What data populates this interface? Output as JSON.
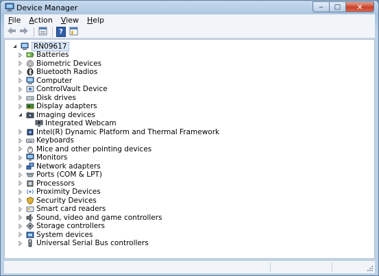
{
  "window": {
    "title": "Device Manager",
    "caption_minimize": "‒",
    "caption_maximize": "□",
    "caption_close": "✕"
  },
  "menu": [
    {
      "label": "File",
      "accel": "F",
      "rest": "ile"
    },
    {
      "label": "Action",
      "accel": "A",
      "rest": "ction"
    },
    {
      "label": "View",
      "accel": "V",
      "rest": "iew"
    },
    {
      "label": "Help",
      "accel": "H",
      "rest": "elp"
    }
  ],
  "toolbar": {
    "back_icon": "back-arrow-icon",
    "forward_icon": "forward-arrow-icon",
    "properties_icon": "properties-icon",
    "help_icon": "help-icon",
    "help_glyph": "?",
    "show_hide_icon": "show-hide-console-tree-icon"
  },
  "tree": {
    "root": {
      "label": "RN09617",
      "icon": "computer-icon",
      "expanded": true
    },
    "items": [
      {
        "label": "Batteries",
        "icon": "battery-icon",
        "expanded": false,
        "level": 1
      },
      {
        "label": "Biometric Devices",
        "icon": "fingerprint-icon",
        "expanded": false,
        "level": 1
      },
      {
        "label": "Bluetooth Radios",
        "icon": "bluetooth-icon",
        "expanded": false,
        "level": 1
      },
      {
        "label": "Computer",
        "icon": "computer-icon",
        "expanded": false,
        "level": 1
      },
      {
        "label": "ControlVault Device",
        "icon": "controlvault-icon",
        "expanded": false,
        "level": 1
      },
      {
        "label": "Disk drives",
        "icon": "disk-drive-icon",
        "expanded": false,
        "level": 1
      },
      {
        "label": "Display adapters",
        "icon": "display-adapter-icon",
        "expanded": false,
        "level": 1
      },
      {
        "label": "Imaging devices",
        "icon": "camera-icon",
        "expanded": true,
        "level": 1
      },
      {
        "label": "Integrated Webcam",
        "icon": "webcam-icon",
        "expanded": null,
        "level": 2
      },
      {
        "label": "Intel(R) Dynamic Platform and Thermal Framework",
        "icon": "chip-icon",
        "expanded": false,
        "level": 1
      },
      {
        "label": "Keyboards",
        "icon": "keyboard-icon",
        "expanded": false,
        "level": 1
      },
      {
        "label": "Mice and other pointing devices",
        "icon": "mouse-icon",
        "expanded": false,
        "level": 1
      },
      {
        "label": "Monitors",
        "icon": "monitor-icon",
        "expanded": false,
        "level": 1
      },
      {
        "label": "Network adapters",
        "icon": "network-icon",
        "expanded": false,
        "level": 1
      },
      {
        "label": "Ports (COM & LPT)",
        "icon": "port-icon",
        "expanded": false,
        "level": 1
      },
      {
        "label": "Processors",
        "icon": "processor-icon",
        "expanded": false,
        "level": 1
      },
      {
        "label": "Proximity Devices",
        "icon": "proximity-icon",
        "expanded": false,
        "level": 1
      },
      {
        "label": "Security Devices",
        "icon": "security-icon",
        "expanded": false,
        "level": 1
      },
      {
        "label": "Smart card readers",
        "icon": "smart-card-icon",
        "expanded": false,
        "level": 1
      },
      {
        "label": "Sound, video and game controllers",
        "icon": "speaker-icon",
        "expanded": false,
        "level": 1
      },
      {
        "label": "Storage controllers",
        "icon": "storage-controller-icon",
        "expanded": false,
        "level": 1
      },
      {
        "label": "System devices",
        "icon": "system-device-icon",
        "expanded": false,
        "level": 1
      },
      {
        "label": "Universal Serial Bus controllers",
        "icon": "usb-icon",
        "expanded": false,
        "level": 1
      }
    ]
  },
  "colors": {
    "window_frame": "#bcd1e8",
    "close_button": "#c8432b",
    "root_highlight": "#dce8f7"
  }
}
